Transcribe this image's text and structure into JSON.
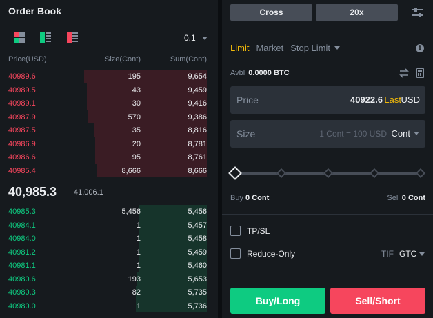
{
  "orderbook": {
    "title": "Order Book",
    "view_icons": [
      "order-book-both-icon",
      "order-book-bids-icon",
      "order-book-asks-icon"
    ],
    "precision": "0.1",
    "headers": {
      "price": "Price(USD)",
      "size": "Size(Cont)",
      "sum": "Sum(Cont)"
    },
    "asks": [
      {
        "price": "40989.6",
        "size": "195",
        "sum": "9,654",
        "depth": 1.0
      },
      {
        "price": "40989.5",
        "size": "43",
        "sum": "9,459",
        "depth": 0.98
      },
      {
        "price": "40989.1",
        "size": "30",
        "sum": "9,416",
        "depth": 0.975
      },
      {
        "price": "40987.9",
        "size": "570",
        "sum": "9,386",
        "depth": 0.972
      },
      {
        "price": "40987.5",
        "size": "35",
        "sum": "8,816",
        "depth": 0.913
      },
      {
        "price": "40986.9",
        "size": "20",
        "sum": "8,781",
        "depth": 0.91
      },
      {
        "price": "40986.6",
        "size": "95",
        "sum": "8,761",
        "depth": 0.908
      },
      {
        "price": "40985.4",
        "size": "8,666",
        "sum": "8,666",
        "depth": 0.898
      }
    ],
    "last_price": "40,985.3",
    "mark_price": "41,006.1",
    "bids": [
      {
        "price": "40985.3",
        "size": "5,456",
        "sum": "5,456",
        "depth": 0.55
      },
      {
        "price": "40984.1",
        "size": "1",
        "sum": "5,457",
        "depth": 0.55
      },
      {
        "price": "40984.0",
        "size": "1",
        "sum": "5,458",
        "depth": 0.55
      },
      {
        "price": "40981.2",
        "size": "1",
        "sum": "5,459",
        "depth": 0.55
      },
      {
        "price": "40981.1",
        "size": "1",
        "sum": "5,460",
        "depth": 0.55
      },
      {
        "price": "40980.6",
        "size": "193",
        "sum": "5,653",
        "depth": 0.57
      },
      {
        "price": "40980.3",
        "size": "82",
        "sum": "5,735",
        "depth": 0.578
      },
      {
        "price": "40980.0",
        "size": "1",
        "sum": "5,736",
        "depth": 0.578
      }
    ],
    "colors": {
      "ask": "#f6465d",
      "bid": "#0ecb81"
    }
  },
  "trade": {
    "margin_mode": "Cross",
    "leverage": "20x",
    "tabs": [
      {
        "label": "Limit",
        "active": true
      },
      {
        "label": "Market",
        "active": false
      },
      {
        "label": "Stop Limit",
        "active": false
      }
    ],
    "avbl_label": "Avbl",
    "avbl_value": "0.0000 BTC",
    "price": {
      "label": "Price",
      "value": "40922.6",
      "last": "Last",
      "currency": "USD"
    },
    "size": {
      "label": "Size",
      "placeholder": "1 Cont = 100 USD",
      "unit": "Cont"
    },
    "slider_level": 0,
    "buy_label": "Buy",
    "buy_value": "0 Cont",
    "sell_label": "Sell",
    "sell_value": "0 Cont",
    "tpsl_label": "TP/SL",
    "reduce_only_label": "Reduce-Only",
    "tif_label": "TIF",
    "tif_value": "GTC",
    "buy_button": "Buy/Long",
    "sell_button": "Sell/Short",
    "colors": {
      "accent": "#f0b90b",
      "buy": "#0ecb81",
      "sell": "#f6465d"
    }
  }
}
